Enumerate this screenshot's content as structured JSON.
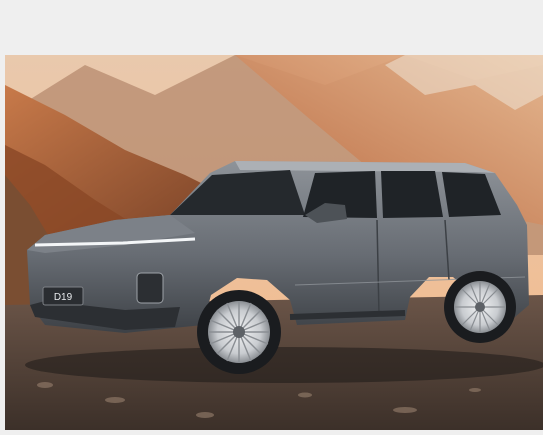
{
  "photo": {
    "plate_text": "D19",
    "colors": {
      "sky": "#f1c9a0",
      "mountain_warm": "#b8643a",
      "mountain_shadow": "#6e3a22",
      "ground": "#5b4a3e",
      "car_body": "#6f747b",
      "car_dark": "#2c2f33",
      "glass": "#1f2327",
      "rim": "#d5d7da"
    }
  }
}
